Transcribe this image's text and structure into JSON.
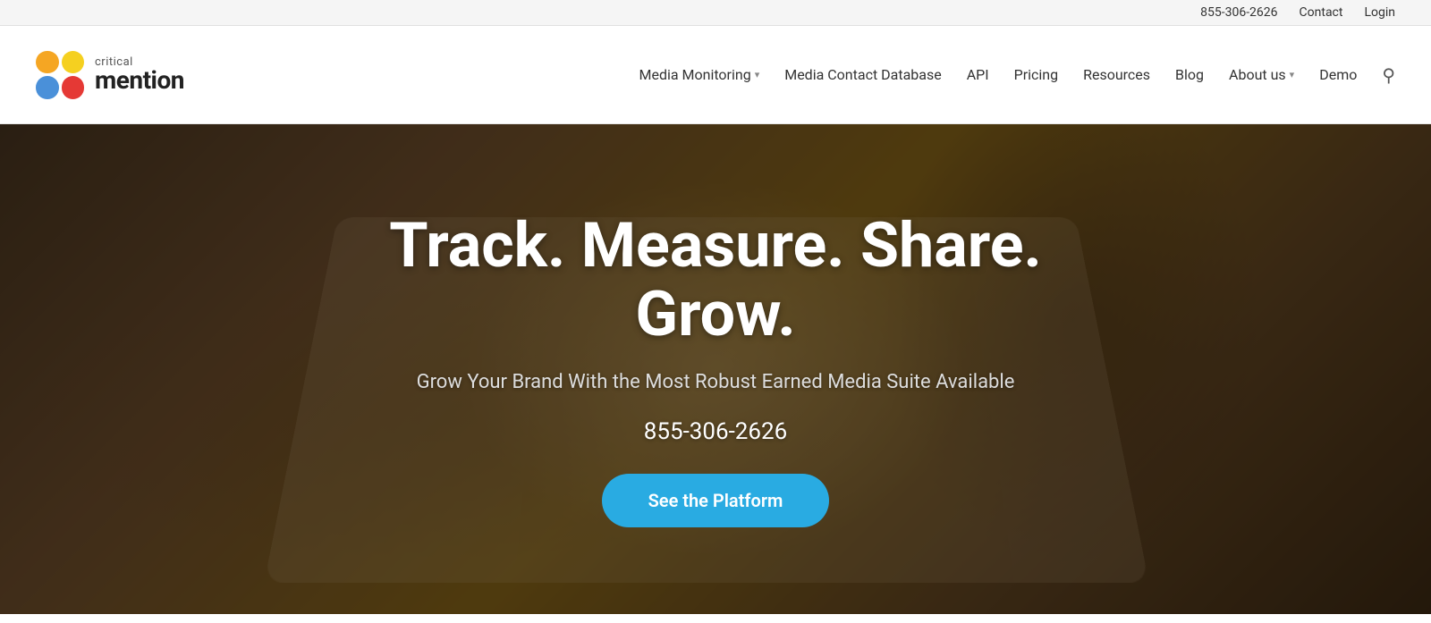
{
  "topbar": {
    "phone": "855-306-2626",
    "contact": "Contact",
    "login": "Login"
  },
  "header": {
    "logo": {
      "critical": "critical",
      "mention": "mention"
    },
    "nav": [
      {
        "id": "media-monitoring",
        "label": "Media Monitoring",
        "hasDropdown": true
      },
      {
        "id": "media-contact-db",
        "label": "Media Contact Database",
        "hasDropdown": false
      },
      {
        "id": "api",
        "label": "API",
        "hasDropdown": false
      },
      {
        "id": "pricing",
        "label": "Pricing",
        "hasDropdown": false
      },
      {
        "id": "resources",
        "label": "Resources",
        "hasDropdown": false
      },
      {
        "id": "blog",
        "label": "Blog",
        "hasDropdown": false
      },
      {
        "id": "about-us",
        "label": "About us",
        "hasDropdown": true
      },
      {
        "id": "demo",
        "label": "Demo",
        "hasDropdown": false
      }
    ]
  },
  "hero": {
    "headline_line1": "Track. Measure. Share.",
    "headline_line2": "Grow.",
    "subheadline": "Grow Your Brand With the Most Robust Earned Media Suite Available",
    "phone": "855-306-2626",
    "cta_label": "See the Platform"
  }
}
